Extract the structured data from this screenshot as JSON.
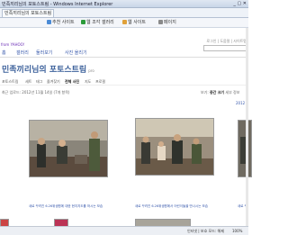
{
  "window": {
    "title": "민족끼리님의 포토스트림 - Windows Internet Explorer",
    "controls": "_ ▢ ✕"
  },
  "tabs": [
    {
      "label": "민족끼리님의 포토스트림"
    }
  ],
  "toolbar": {
    "items": [
      {
        "label": "추천 사이트"
      },
      {
        "label": "웹 조각 갤러리"
      },
      {
        "label": "웹 사이트"
      },
      {
        "label": "페이지"
      }
    ]
  },
  "site": {
    "brand": "from YAHOO!",
    "topright": "로그인 | 도움말 | 사이트맵",
    "nav": [
      "홈",
      "갤러리",
      "둘러보기",
      "사진 올리기"
    ]
  },
  "page": {
    "title": "민족끼리님의 포토스트림",
    "badge": "pro",
    "crumbs": [
      "포토스트림",
      "세트",
      "태그",
      "즐겨찾기",
      "전체 사진",
      "지도",
      "프로필"
    ],
    "meta": "최근 업로드: 2012년 11월 14일 (7개 항목)",
    "view_label": "보기:",
    "view_value": "중간 크기",
    "view_extra": "세부 정보",
    "year": "2012"
  },
  "photos": [
    {
      "caption": "새로 꾸려진 6.26위생원에 대한 현지지도를 하시는 모습"
    },
    {
      "caption": "새로 꾸려진 6.26위생원에서 어린이들을 만나시는 모습"
    },
    {
      "caption": "새로 꾸려진"
    }
  ],
  "status": {
    "zone": "인터넷 | 보호 모드: 해제",
    "zoom": "100%"
  }
}
